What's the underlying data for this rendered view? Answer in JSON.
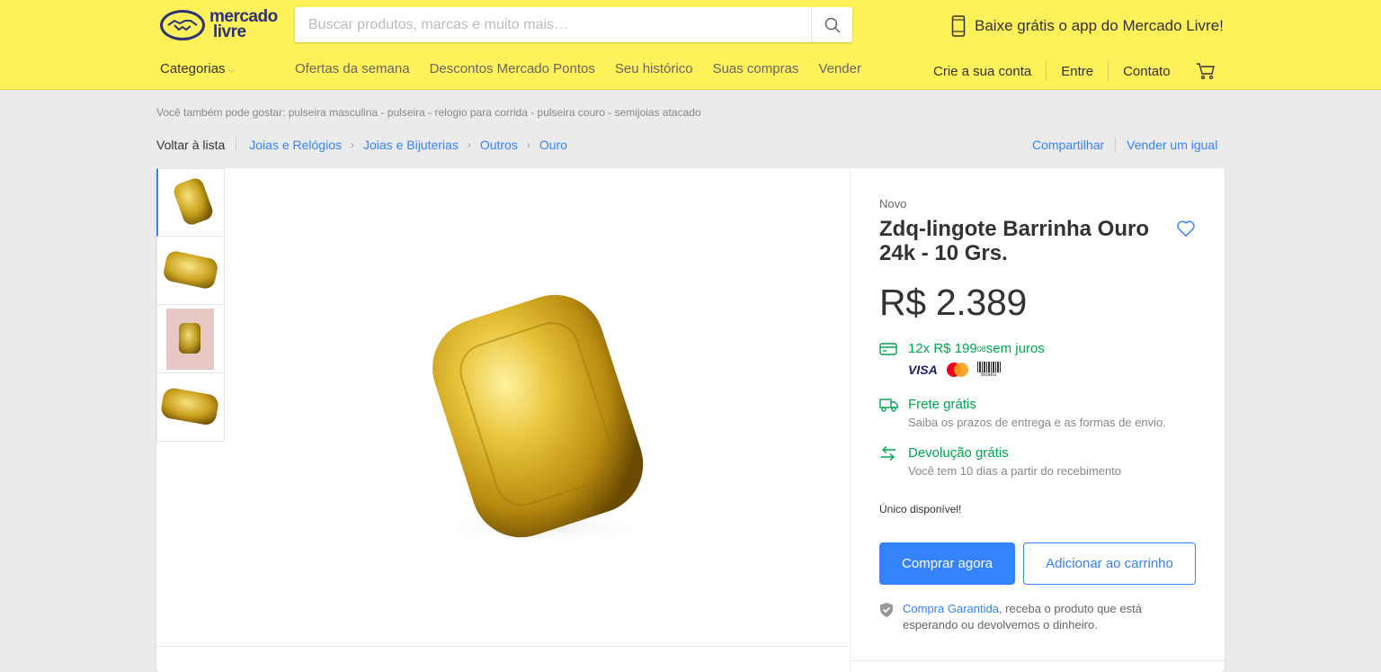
{
  "header": {
    "logo_line1": "mercado",
    "logo_line2": "livre",
    "search_placeholder": "Buscar produtos, marcas e muito mais…",
    "app_promo": "Baixe grátis o app do Mercado Livre!",
    "categories": "Categorias",
    "nav_links": [
      "Ofertas da semana",
      "Descontos Mercado Pontos",
      "Seu histórico",
      "Suas compras",
      "Vender"
    ],
    "account_links": [
      "Crie a sua conta",
      "Entre",
      "Contato"
    ]
  },
  "suggestions": "Você também pode gostar: pulseira masculina - pulseira - relogio para corrida - pulseira couro - semijoias atacado",
  "breadcrumb": {
    "back": "Voltar à lista",
    "items": [
      "Joias e Relógios",
      "Joias e Bijuterias",
      "Outros",
      "Ouro"
    ],
    "share": "Compartilhar",
    "sell_similar": "Vender um igual"
  },
  "product": {
    "condition": "Novo",
    "title": "Zdq-lingote Barrinha Ouro 24k - 10 Grs.",
    "price": "R$ 2.389",
    "installments_prefix": "12x R$ 199",
    "installments_cents": "08",
    "installments_suffix": " sem juros",
    "payment_visa": "VISA",
    "payment_boleto": "Boleto",
    "shipping_title": "Frete grátis",
    "shipping_sub": "Saiba os prazos de entrega e as formas de envio.",
    "return_title": "Devolução grátis",
    "return_sub": "Você tem 10 dias a partir do recebimento",
    "stock": "Único disponível!",
    "buy_now": "Comprar agora",
    "add_to_cart": "Adicionar ao carrinho",
    "guarantee_link": "Compra Garantida",
    "guarantee_text": ", receba o produto que está esperando ou devolvemos o dinheiro."
  },
  "colors": {
    "header_bg": "#fff159",
    "accent_blue": "#3483fa",
    "green": "#00a650"
  }
}
